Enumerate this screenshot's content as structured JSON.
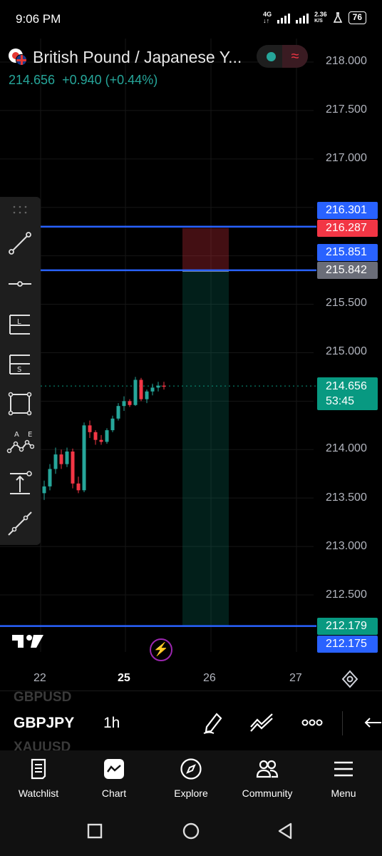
{
  "status_bar": {
    "time": "9:06 PM",
    "network": "4G",
    "speed_value": "2.36",
    "speed_unit": "K/S",
    "battery": "76"
  },
  "header": {
    "title": "British Pound / Japanese Y...",
    "last_price": "214.656",
    "change": "+0.940 (+0.44%)",
    "up_color": "#26a69a",
    "down_color": "#f23645"
  },
  "y_axis": {
    "labels": [
      "218.000",
      "217.500",
      "217.000",
      "215.500",
      "215.000",
      "214.000",
      "213.500",
      "213.000",
      "212.500"
    ]
  },
  "price_tags": {
    "line1_upper": "216.301",
    "line1_lower": "216.287",
    "line2_upper": "215.851",
    "line2_lower": "215.842",
    "current_price": "214.656",
    "countdown": "53:45",
    "line3_upper": "212.179",
    "line3_lower": "212.175"
  },
  "x_axis": {
    "labels": [
      "22",
      "25",
      "26",
      "27"
    ]
  },
  "toolbar": {
    "tools": [
      "trend-line-tool",
      "horizontal-ray-tool",
      "long-position-tool",
      "short-position-tool",
      "rectangle-tool",
      "abcd-pattern-tool",
      "price-range-tool",
      "extended-line-tool"
    ]
  },
  "symbol_bar": {
    "prev_symbol": "GBPUSD",
    "symbol": "GBPJPY",
    "next_symbol": "XAUUSD",
    "interval": "1h"
  },
  "nav": {
    "watchlist": "Watchlist",
    "chart": "Chart",
    "explore": "Explore",
    "community": "Community",
    "menu": "Menu"
  },
  "chart_data": {
    "type": "candlestick",
    "symbol": "GBPJPY",
    "interval": "1h",
    "last": 214.656,
    "horizontal_lines": [
      216.301,
      215.851,
      212.179
    ],
    "position_tool": {
      "entry": 215.842,
      "stop": 216.287,
      "target": 212.175
    },
    "ylim": [
      212.0,
      218.2
    ],
    "x_ticks": [
      "22",
      "25",
      "26",
      "27"
    ],
    "candles": [
      [
        213.55,
        213.68,
        213.48,
        213.62
      ],
      [
        213.62,
        213.85,
        213.58,
        213.8
      ],
      [
        213.8,
        214.02,
        213.75,
        213.95
      ],
      [
        213.95,
        214.0,
        213.8,
        213.85
      ],
      [
        213.85,
        214.02,
        213.82,
        213.98
      ],
      [
        213.98,
        214.01,
        213.6,
        213.65
      ],
      [
        213.65,
        213.72,
        213.55,
        213.58
      ],
      [
        213.58,
        214.28,
        213.56,
        214.25
      ],
      [
        214.25,
        214.3,
        214.12,
        214.18
      ],
      [
        214.18,
        214.2,
        214.05,
        214.1
      ],
      [
        214.1,
        214.15,
        214.05,
        214.08
      ],
      [
        214.08,
        214.22,
        214.06,
        214.2
      ],
      [
        214.2,
        214.35,
        214.18,
        214.32
      ],
      [
        214.32,
        214.48,
        214.3,
        214.45
      ],
      [
        214.45,
        214.55,
        214.4,
        214.5
      ],
      [
        214.5,
        214.52,
        214.44,
        214.46
      ],
      [
        214.46,
        214.75,
        214.45,
        214.72
      ],
      [
        214.72,
        214.74,
        214.5,
        214.52
      ],
      [
        214.52,
        214.62,
        214.48,
        214.6
      ],
      [
        214.6,
        214.68,
        214.56,
        214.64
      ],
      [
        214.64,
        214.7,
        214.6,
        214.66
      ],
      [
        214.66,
        214.7,
        214.62,
        214.656
      ]
    ]
  }
}
